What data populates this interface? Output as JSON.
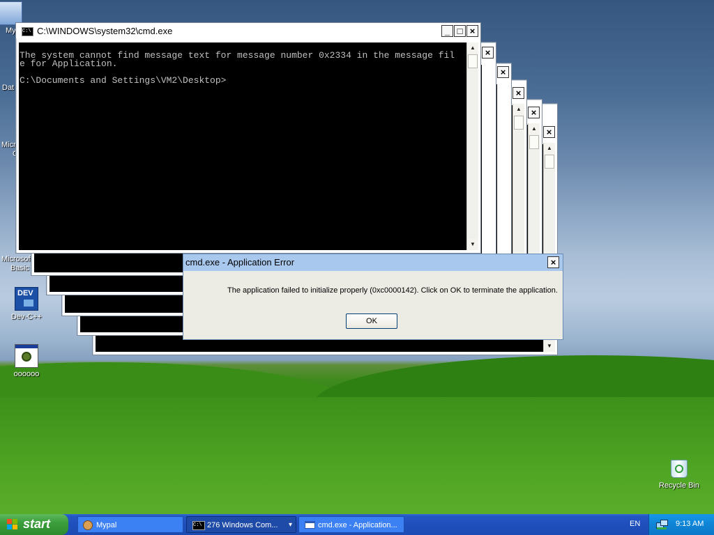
{
  "desktop": {
    "icons": [
      {
        "label": "My",
        "icon": "my-computer-icon"
      },
      {
        "label": "Dat",
        "icon": "documents-icon"
      },
      {
        "label": "Micro",
        "icon": "ms-app-icon"
      },
      {
        "label": "C",
        "icon": "ms-app-icon"
      },
      {
        "label": "Microsoft",
        "icon": "vb-icon"
      },
      {
        "label": "Basic",
        "icon": "vb-icon"
      },
      {
        "label": "Dev-C++",
        "icon": "dev-cpp-icon"
      },
      {
        "label": "oooooo",
        "icon": "exe-app-icon"
      },
      {
        "label": "Recycle Bin",
        "icon": "recycle-bin-icon"
      }
    ],
    "dev_badge": "DEV"
  },
  "cmd_window": {
    "title": "C:\\WINDOWS\\system32\\cmd.exe",
    "title_icon": "C:\\",
    "line1": "The system cannot find message text for message number 0x2334 in the message fil",
    "line2": "e for Application.",
    "prompt": "C:\\Documents and Settings\\VM2\\Desktop>",
    "controls": {
      "minimize": "_",
      "maximize": "□",
      "close": "×"
    }
  },
  "stacked_close": "×",
  "stacked_max": "□",
  "scroll_up": "▲",
  "scroll_down": "▼",
  "error_dialog": {
    "title": "cmd.exe - Application Error",
    "message": "The application failed to initialize properly (0xc0000142). Click on OK to terminate the application.",
    "ok_label": "OK",
    "close": "×"
  },
  "taskbar": {
    "start_label": "start",
    "items": [
      {
        "label": "Mypal",
        "icon": "mypal-icon"
      },
      {
        "label": "276 Windows Com...",
        "icon": "cmd-icon",
        "badge": "C:\\"
      },
      {
        "label": "cmd.exe - Application...",
        "icon": "window-icon"
      }
    ],
    "dropdown": "▾",
    "lang": "EN",
    "clock": "9:13 AM"
  },
  "colors": {
    "console_bg": "#000000",
    "console_text": "#c0c0c0",
    "taskbar": "#245edb",
    "tray": "#0f84d6"
  }
}
